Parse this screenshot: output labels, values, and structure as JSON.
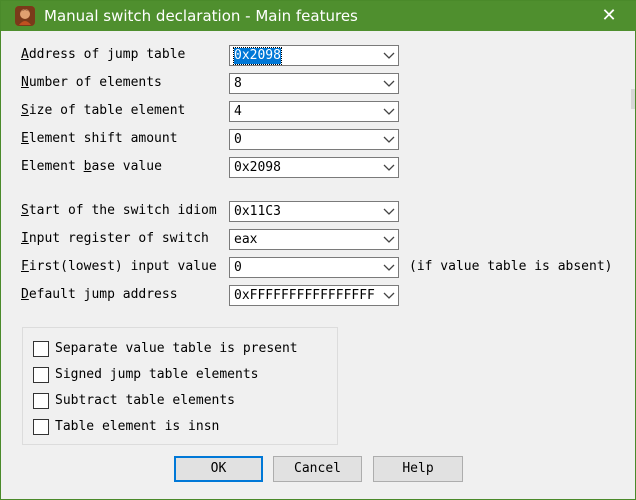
{
  "titlebar": {
    "title": "Manual switch declaration - Main features",
    "close_glyph": "✕",
    "app_icon": "ida-app-icon"
  },
  "fields": [
    {
      "label": "Address of jump table",
      "hotkey_index": 0,
      "value": "0x2098",
      "selected": true
    },
    {
      "label": "Number of elements",
      "hotkey_index": 0,
      "value": "8"
    },
    {
      "label": "Size of table element",
      "hotkey_index": 0,
      "value": "4"
    },
    {
      "label": "Element shift amount",
      "hotkey_index": 0,
      "value": "0"
    },
    {
      "label": "Element base value",
      "hotkey_index": 8,
      "value": "0x2098"
    },
    {
      "label": "Start of the switch idiom",
      "hotkey_index": 0,
      "value": "0x11C3"
    },
    {
      "label": "Input register of switch",
      "hotkey_index": 0,
      "value": "eax"
    },
    {
      "label": "First(lowest) input value",
      "hotkey_index": 0,
      "value": "0"
    },
    {
      "label": "Default jump address",
      "hotkey_index": 0,
      "value": "0xFFFFFFFFFFFFFFFF"
    }
  ],
  "first_input_note": "(if value table is absent)",
  "options": [
    {
      "label": "Separate value table is present",
      "checked": false
    },
    {
      "label": "Signed jump table elements",
      "checked": false
    },
    {
      "label": "Subtract table elements",
      "checked": false
    },
    {
      "label": "Table element is insn",
      "checked": false
    }
  ],
  "buttons": {
    "ok": "OK",
    "cancel": "Cancel",
    "help": "Help"
  },
  "colors": {
    "titlebar": "#4f8f2e",
    "selection": "#0078d7"
  }
}
